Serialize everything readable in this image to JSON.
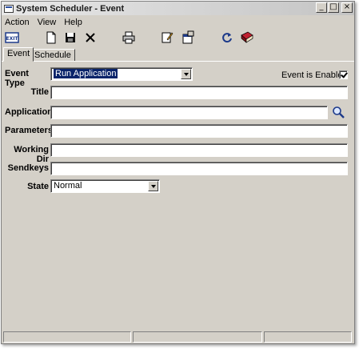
{
  "window": {
    "title": "System Scheduler - Event"
  },
  "title_buttons": {
    "minimize": "_",
    "maximize": "□",
    "close": "×"
  },
  "menu": {
    "items": [
      "Action",
      "View",
      "Help"
    ]
  },
  "toolbar": {
    "exit_label": "EXIT",
    "icons": [
      "exit-icon",
      "new-icon",
      "save-icon",
      "delete-icon",
      "print-icon",
      "edit-icon",
      "properties-icon",
      "refresh-icon",
      "help-book-icon"
    ]
  },
  "tabs": [
    {
      "label": "Event",
      "active": true
    },
    {
      "label": "Schedule",
      "active": false
    }
  ],
  "form": {
    "event_type_label": "Event Type",
    "event_type_value": "Run Application",
    "event_enabled_label": "Event is Enabled",
    "event_enabled": true,
    "title_label": "Title",
    "title_value": "",
    "application_label": "Application",
    "application_value": "",
    "parameters_label": "Parameters",
    "parameters_value": "",
    "working_dir_label": "Working Dir",
    "working_dir_value": "",
    "sendkeys_label": "Sendkeys",
    "sendkeys_value": "",
    "state_label": "State",
    "state_value": "Normal"
  },
  "colors": {
    "face": "#d4d0c8",
    "selection": "#0a246a"
  }
}
